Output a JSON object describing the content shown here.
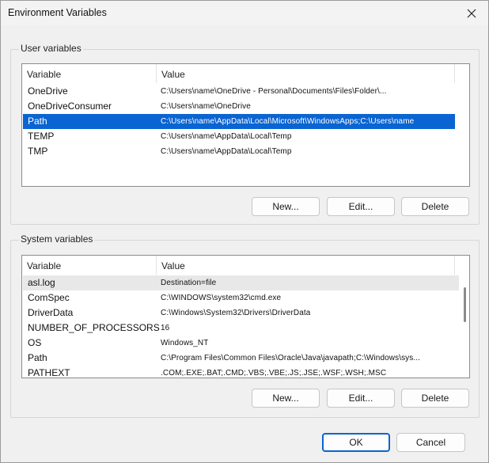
{
  "window": {
    "title": "Environment Variables"
  },
  "icons": {
    "close": "close-icon"
  },
  "user_section": {
    "label": "User variables",
    "columns": [
      "Variable",
      "Value"
    ],
    "rows": [
      {
        "name": "OneDrive",
        "value": "C:\\Users\\name\\OneDrive - Personal\\Documents\\Files\\Folder\\...",
        "state": ""
      },
      {
        "name": "OneDriveConsumer",
        "value": "C:\\Users\\name\\OneDrive",
        "state": ""
      },
      {
        "name": "Path",
        "value": "C:\\Users\\name\\AppData\\Local\\Microsoft\\WindowsApps;C:\\Users\\name\\Files\\...",
        "state": "selected"
      },
      {
        "name": "TEMP",
        "value": "C:\\Users\\name\\AppData\\Local\\Temp",
        "state": ""
      },
      {
        "name": "TMP",
        "value": "C:\\Users\\name\\AppData\\Local\\Temp",
        "state": ""
      }
    ],
    "buttons": {
      "new": "New...",
      "edit": "Edit...",
      "delete": "Delete"
    }
  },
  "system_section": {
    "label": "System variables",
    "columns": [
      "Variable",
      "Value"
    ],
    "rows": [
      {
        "name": "asl.log",
        "value": "Destination=file",
        "state": "hover"
      },
      {
        "name": "ComSpec",
        "value": "C:\\WINDOWS\\system32\\cmd.exe",
        "state": ""
      },
      {
        "name": "DriverData",
        "value": "C:\\Windows\\System32\\Drivers\\DriverData",
        "state": ""
      },
      {
        "name": "NUMBER_OF_PROCESSORS",
        "value": "16",
        "state": ""
      },
      {
        "name": "OS",
        "value": "Windows_NT",
        "state": ""
      },
      {
        "name": "Path",
        "value": "C:\\Program Files\\Common Files\\Oracle\\Java\\javapath;C:\\Windows\\sys...",
        "state": ""
      },
      {
        "name": "PATHEXT",
        "value": ".COM;.EXE;.BAT;.CMD;.VBS;.VBE;.JS;.JSE;.WSF;.WSH;.MSC",
        "state": ""
      }
    ],
    "buttons": {
      "new": "New...",
      "edit": "Edit...",
      "delete": "Delete"
    }
  },
  "footer": {
    "ok": "OK",
    "cancel": "Cancel"
  },
  "colors": {
    "selection": "#0a64d2",
    "default_button_border": "#0a64d2"
  }
}
